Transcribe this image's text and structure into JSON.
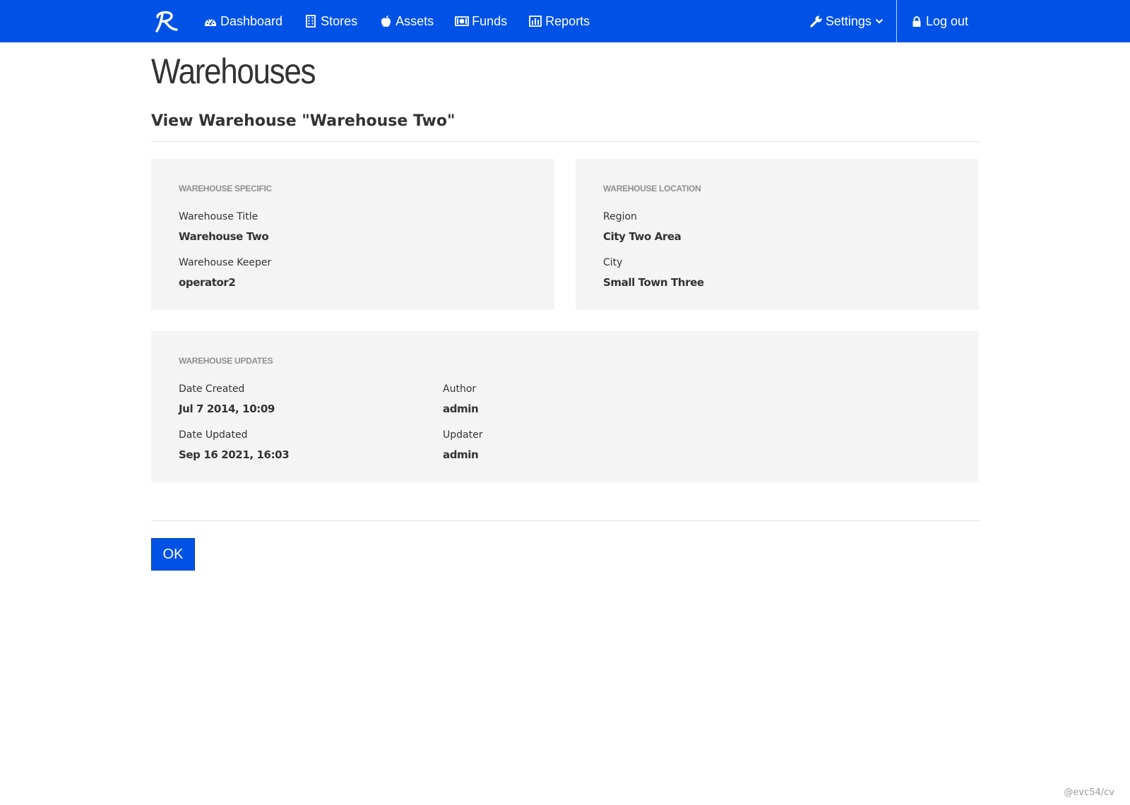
{
  "nav": {
    "items": [
      {
        "label": "Dashboard",
        "icon": "dashboard-icon"
      },
      {
        "label": "Stores",
        "icon": "building-icon"
      },
      {
        "label": "Assets",
        "icon": "apple-icon"
      },
      {
        "label": "Funds",
        "icon": "money-icon"
      },
      {
        "label": "Reports",
        "icon": "bar-chart-icon"
      }
    ],
    "settings_label": "Settings",
    "logout_label": "Log out",
    "bar_color": "#0052e6"
  },
  "page": {
    "title": "Warehouses",
    "subtitle": "View Warehouse \"Warehouse Two\""
  },
  "specific": {
    "heading": "WAREHOUSE SPECIFIC",
    "title_label": "Warehouse Title",
    "title_value": "Warehouse Two",
    "keeper_label": "Warehouse Keeper",
    "keeper_value": "operator2"
  },
  "location": {
    "heading": "WAREHOUSE LOCATION",
    "region_label": "Region",
    "region_value": "City Two Area",
    "city_label": "City",
    "city_value": "Small Town Three"
  },
  "updates": {
    "heading": "WAREHOUSE UPDATES",
    "created_label": "Date Created",
    "created_value": "Jul 7 2014, 10:09",
    "author_label": "Author",
    "author_value": "admin",
    "updated_label": "Date Updated",
    "updated_value": "Sep 16 2021, 16:03",
    "updater_label": "Updater",
    "updater_value": "admin"
  },
  "actions": {
    "ok_label": "OK"
  },
  "footer": {
    "credit": "@evc54/cv"
  }
}
